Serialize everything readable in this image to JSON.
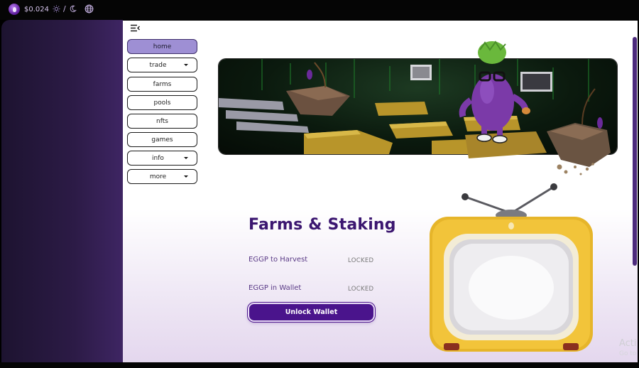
{
  "topbar": {
    "price": "$0.024",
    "theme_separator": "/",
    "icons": {
      "token": "eggp-token-icon",
      "light": "sun-icon",
      "dark": "moon-icon",
      "language": "globe-icon"
    }
  },
  "nav": {
    "toggle_icon": "menu-collapse-icon",
    "items": [
      {
        "label": "home",
        "active": true,
        "dropdown": false
      },
      {
        "label": "trade",
        "active": false,
        "dropdown": true
      },
      {
        "label": "farms",
        "active": false,
        "dropdown": false
      },
      {
        "label": "pools",
        "active": false,
        "dropdown": false
      },
      {
        "label": "nfts",
        "active": false,
        "dropdown": false
      },
      {
        "label": "games",
        "active": false,
        "dropdown": false
      },
      {
        "label": "info",
        "active": false,
        "dropdown": true
      },
      {
        "label": "more",
        "active": false,
        "dropdown": true
      }
    ]
  },
  "farms": {
    "title": "Farms & Staking",
    "harvest_label": "EGGP to Harvest",
    "harvest_value": "LOCKED",
    "wallet_label": "EGGP in Wallet",
    "wallet_value": "LOCKED",
    "unlock_button": "Unlock Wallet"
  },
  "watermark": {
    "line1": "Acti",
    "line2": "Go to"
  },
  "colors": {
    "accent": "#4a148c",
    "active_nav": "#9e8fd4",
    "title": "#3b1670"
  }
}
